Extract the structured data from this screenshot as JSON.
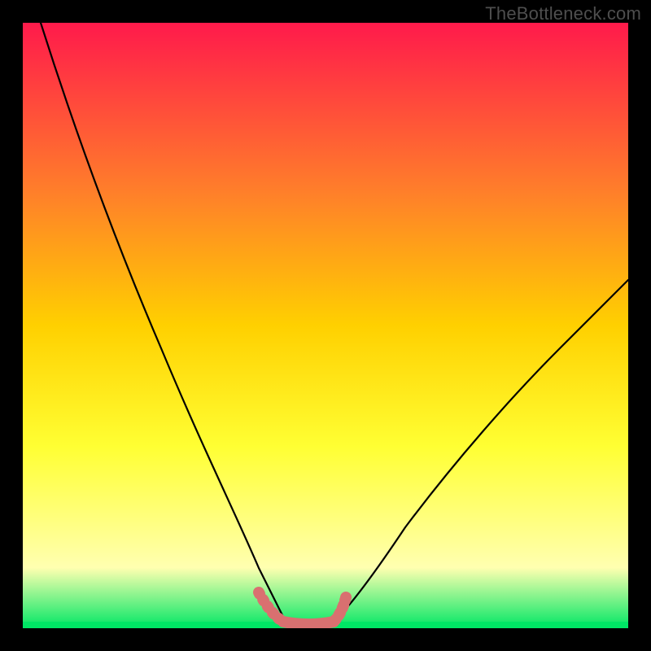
{
  "watermark": "TheBottleneck.com",
  "colors": {
    "gradient_top": "#ff1a4b",
    "gradient_mid1": "#ff7f2a",
    "gradient_mid2": "#ffd000",
    "gradient_mid3": "#ffff33",
    "gradient_fade": "#ffffb0",
    "gradient_bottom": "#00e765",
    "curve": "#000000",
    "marker": "#d97070",
    "frame": "#000000"
  },
  "chart_data": {
    "type": "line",
    "title": "",
    "xlabel": "",
    "ylabel": "",
    "xlim": [
      0,
      100
    ],
    "ylim": [
      0,
      100
    ],
    "note": "No axes, ticks, or numeric labels are rendered in the image. Curve values are visual estimates of the rendered black curve (y = 0 is the bottom green band, y = 100 is the top).",
    "series": [
      {
        "name": "curve-left",
        "x": [
          3,
          8,
          12,
          16,
          20,
          24,
          28,
          32,
          35,
          37,
          39,
          41,
          43
        ],
        "values": [
          100,
          85,
          74,
          62,
          51,
          40,
          29,
          18,
          10,
          6,
          3,
          1.5,
          0.8
        ]
      },
      {
        "name": "curve-right",
        "x": [
          50,
          53,
          57,
          62,
          68,
          74,
          80,
          86,
          92,
          98,
          100
        ],
        "values": [
          0.8,
          2.5,
          6,
          12,
          19,
          27,
          35,
          42,
          49,
          55,
          58
        ]
      },
      {
        "name": "marker-band",
        "style": "thick-pink",
        "x": [
          39,
          41,
          43,
          45,
          47,
          49,
          51,
          52,
          52.5
        ],
        "values": [
          4,
          2,
          1,
          0.8,
          0.8,
          0.8,
          1.2,
          3,
          5
        ]
      }
    ]
  }
}
